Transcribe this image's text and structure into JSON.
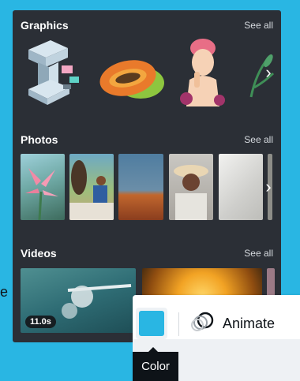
{
  "graphics": {
    "title": "Graphics",
    "see_all": "See all",
    "next_icon": "chevron-right-icon"
  },
  "photos": {
    "title": "Photos",
    "see_all": "See all",
    "next_icon": "chevron-right-icon"
  },
  "videos": {
    "title": "Videos",
    "see_all": "See all",
    "items": [
      {
        "duration": "11.0s"
      }
    ],
    "next_icon": "chevron-right-icon"
  },
  "toolbar": {
    "color_label": "Color",
    "color_value": "#29b6e3",
    "animate_label": "Animate",
    "animate_icon": "animate-circles-icon"
  },
  "edge_fragment": "e",
  "colors": {
    "panel": "#2b2f36",
    "background": "#29b6e3"
  }
}
